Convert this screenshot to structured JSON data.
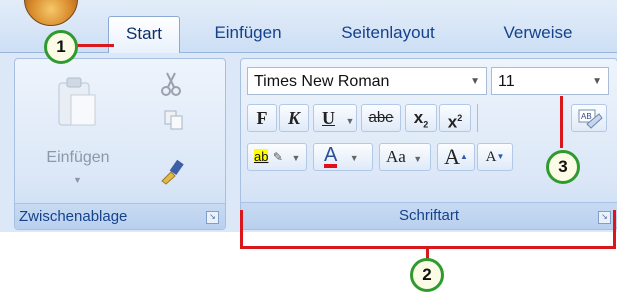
{
  "tabs": [
    {
      "label": "Start",
      "active": true
    },
    {
      "label": "Einfügen",
      "active": false
    },
    {
      "label": "Seitenlayout",
      "active": false
    },
    {
      "label": "Verweise",
      "active": false
    }
  ],
  "clipboard_group": {
    "label": "Zwischenablage",
    "paste_label": "Einfügen",
    "paste_icon": "clipboard-icon",
    "cut_icon": "scissors-icon",
    "copy_icon": "copy-icon",
    "format_painter_icon": "brush-icon"
  },
  "font_group": {
    "label": "Schriftart",
    "font_name": "Times New Roman",
    "font_size": "11",
    "bold": "F",
    "italic": "K",
    "underline": "U",
    "strikethrough": "abe",
    "subscript": "x",
    "subscript_mark": "2",
    "superscript": "x",
    "superscript_mark": "2",
    "highlight_text": "ab",
    "font_color": "A",
    "change_case": "Aa",
    "grow": "A",
    "shrink": "A",
    "clear_format_text": "AB"
  },
  "callouts": [
    "1",
    "2",
    "3"
  ],
  "colors": {
    "highlight_yellow": "#ffff00",
    "font_red": "#e0101a",
    "callout_green": "#2f9b2f",
    "annotation_red": "#d9181e"
  }
}
